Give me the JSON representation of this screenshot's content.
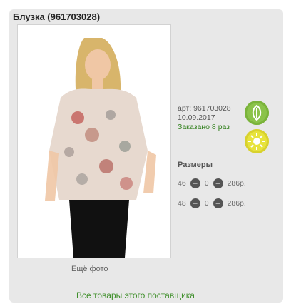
{
  "product": {
    "title": "Блузка (961703028)",
    "more_photos": "Ещё фото",
    "article": "арт: 961703028",
    "date": "10.09.2017",
    "ordered": "Заказано 8 раз",
    "sizes_title": "Размеры",
    "sizes": [
      {
        "size": "46",
        "qty": "0",
        "price": "286р."
      },
      {
        "size": "48",
        "qty": "0",
        "price": "286р."
      }
    ],
    "supplier_link": "Все товары этого поставщика"
  },
  "icons": {
    "leaf": "leaf-icon",
    "sun": "sun-icon"
  },
  "colors": {
    "leaf": "#8bc34a",
    "sun": "#e7e33d",
    "link": "#3f8f2b"
  }
}
